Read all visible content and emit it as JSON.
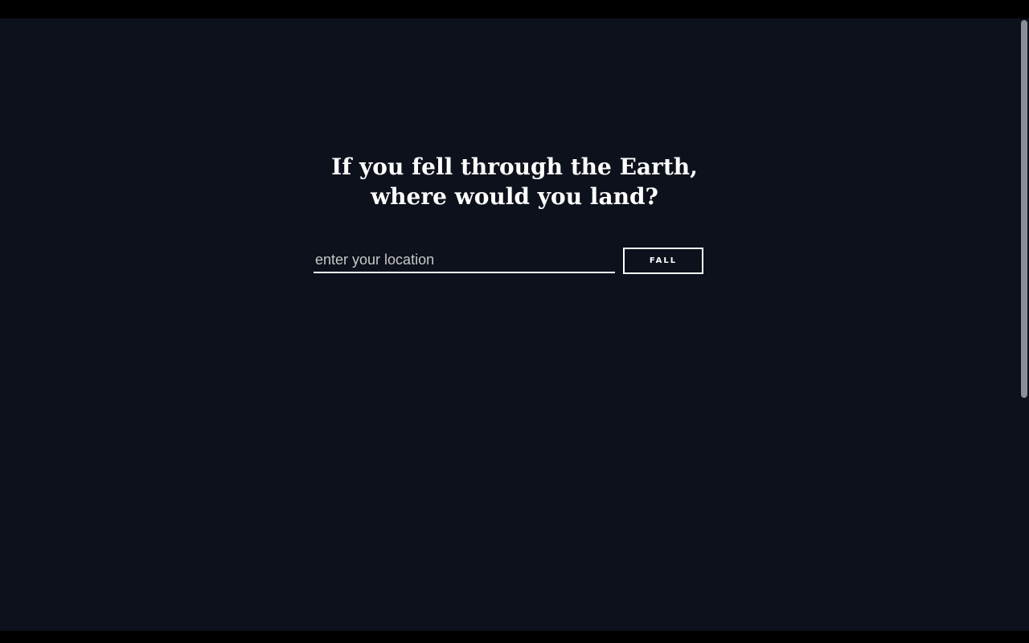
{
  "heading": {
    "line1": "If you fell through the Earth,",
    "line2": "where would you land?"
  },
  "search": {
    "placeholder": "enter your location",
    "value": ""
  },
  "button": {
    "label": "FALL"
  }
}
